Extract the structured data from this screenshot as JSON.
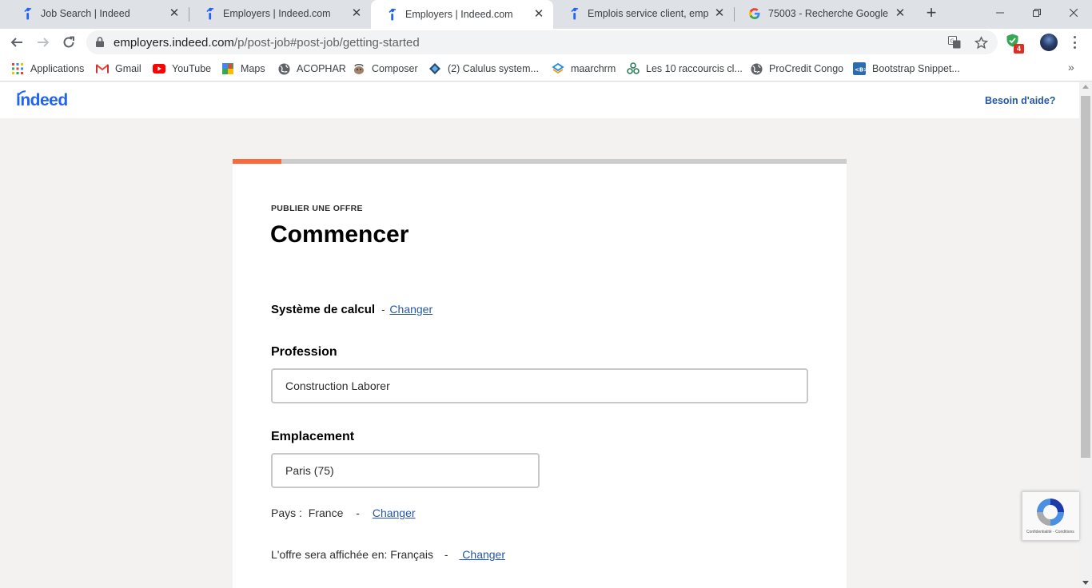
{
  "browser": {
    "tabs": [
      {
        "title": "Job Search | Indeed",
        "favicon": "indeed-icon",
        "active": false
      },
      {
        "title": "Employers | Indeed.com",
        "favicon": "indeed-icon",
        "active": false
      },
      {
        "title": "Employers | Indeed.com",
        "favicon": "indeed-icon",
        "active": true
      },
      {
        "title": "Emplois service client, emploi",
        "favicon": "indeed-icon",
        "active": false
      },
      {
        "title": "75003 - Recherche Google",
        "favicon": "google-icon",
        "active": false
      }
    ],
    "url": {
      "host": "employers.indeed.com",
      "path": "/p/post-job#post-job/getting-started"
    },
    "extension_badge": "4",
    "bookmarks": [
      {
        "label": "Applications",
        "icon": "apps-grid-icon"
      },
      {
        "label": "Gmail",
        "icon": "gmail-icon"
      },
      {
        "label": "YouTube",
        "icon": "youtube-icon"
      },
      {
        "label": "Maps",
        "icon": "maps-icon"
      },
      {
        "label": "ACOPHAR",
        "icon": "globe-icon"
      },
      {
        "label": "Composer",
        "icon": "composer-icon"
      },
      {
        "label": "(2) Calulus system...",
        "icon": "calculus-icon"
      },
      {
        "label": "maarchrm",
        "icon": "maarch-icon"
      },
      {
        "label": "Les 10 raccourcis cl...",
        "icon": "shortcuts-icon"
      },
      {
        "label": "ProCredit Congo",
        "icon": "globe-icon"
      },
      {
        "label": "Bootstrap Snippet...",
        "icon": "bootstrap-icon"
      }
    ],
    "bookmarks_overflow": "»"
  },
  "site": {
    "logo": "indeed",
    "help_link": "Besoin d'aide?",
    "brand_color": "#2557a7",
    "accent_color": "#f96b3b"
  },
  "form": {
    "progress_fraction": 0.08,
    "eyebrow": "PUBLIER UNE OFFRE",
    "title": "Commencer",
    "system": {
      "label": "Système de calcul",
      "separator": "-",
      "change": "Changer"
    },
    "profession": {
      "label": "Profession",
      "value": "Construction Laborer"
    },
    "location": {
      "label": "Emplacement",
      "value": "Paris (75)"
    },
    "country": {
      "label": "Pays :",
      "value": "France",
      "separator": "-",
      "change": "Changer"
    },
    "language": {
      "label": "L'offre sera affichée en:",
      "value": "Français",
      "separator": "-",
      "change": " Changer"
    }
  },
  "recaptcha": {
    "text": "Confidentialité - Conditions"
  }
}
